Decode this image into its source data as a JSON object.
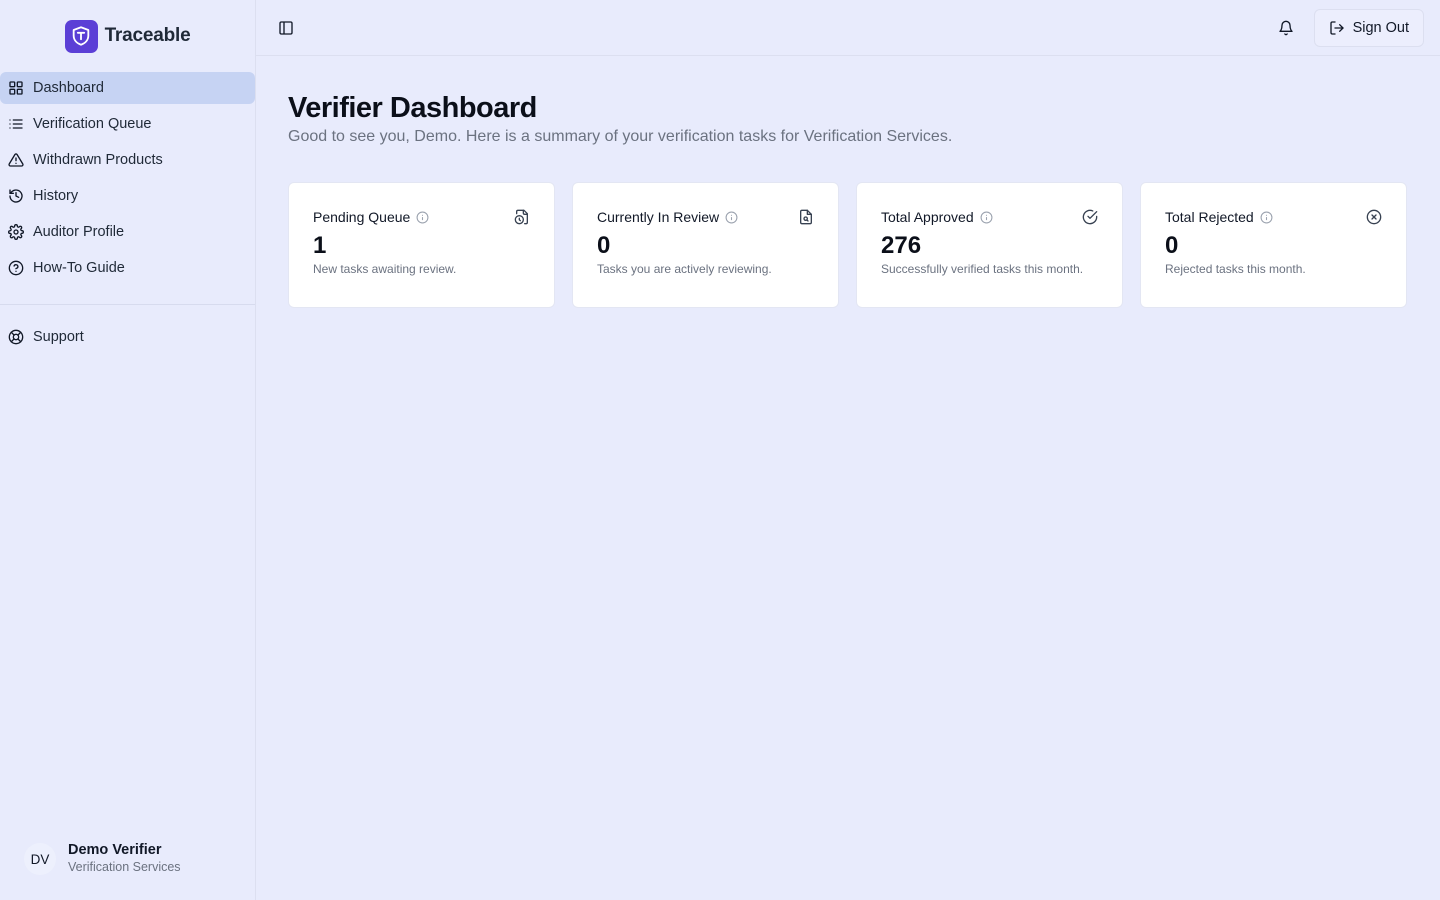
{
  "brand": {
    "name": "Traceable",
    "color": "#5b3fd6"
  },
  "sidebar": {
    "items": [
      {
        "label": "Dashboard",
        "icon": "grid-icon",
        "active": true
      },
      {
        "label": "Verification Queue",
        "icon": "list-icon"
      },
      {
        "label": "Withdrawn Products",
        "icon": "warning-icon"
      },
      {
        "label": "History",
        "icon": "history-icon"
      },
      {
        "label": "Auditor Profile",
        "icon": "gear-icon"
      },
      {
        "label": "How-To Guide",
        "icon": "help-circle-icon"
      }
    ],
    "secondary": [
      {
        "label": "Support",
        "icon": "lifebuoy-icon"
      }
    ]
  },
  "user": {
    "initials": "DV",
    "name": "Demo Verifier",
    "org": "Verification Services"
  },
  "topbar": {
    "signout_label": "Sign Out"
  },
  "page": {
    "title": "Verifier Dashboard",
    "subtitle": "Good to see you, Demo. Here is a summary of your verification tasks for Verification Services."
  },
  "cards": [
    {
      "title": "Pending Queue",
      "value": "1",
      "desc": "New tasks awaiting review.",
      "icon": "file-clock-icon"
    },
    {
      "title": "Currently In Review",
      "value": "0",
      "desc": "Tasks you are actively reviewing.",
      "icon": "file-search-icon"
    },
    {
      "title": "Total Approved",
      "value": "276",
      "desc": "Successfully verified tasks this month.",
      "icon": "check-circle-icon"
    },
    {
      "title": "Total Rejected",
      "value": "0",
      "desc": "Rejected tasks this month.",
      "icon": "x-circle-icon"
    }
  ]
}
